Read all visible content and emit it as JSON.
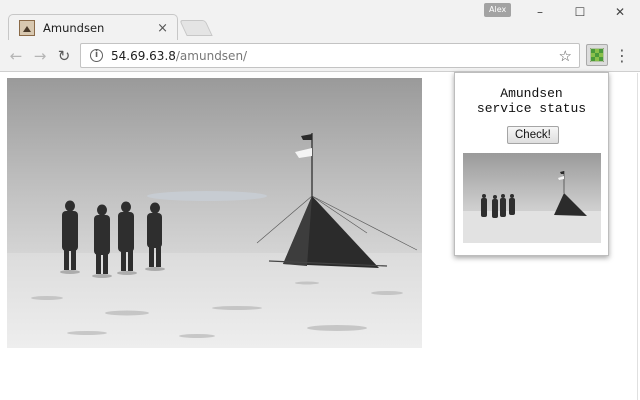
{
  "window": {
    "profile_name": "Alex",
    "minimize_icon": "minimize-icon",
    "maximize_icon": "maximize-icon",
    "close_icon": "close-icon"
  },
  "tab": {
    "title": "Amundsen",
    "favicon": "picture-favicon",
    "close_glyph": "×"
  },
  "toolbar": {
    "back_glyph": "←",
    "forward_glyph": "→",
    "reload_glyph": "↻",
    "url_host": "54.69.63.8",
    "url_path": "/amundsen/",
    "star_glyph": "☆",
    "menu_glyph": "⋮"
  },
  "extension_popup": {
    "title_line1": "Amundsen",
    "title_line2": "service status",
    "check_button_label": "Check!",
    "thumbnail_icon": "amundsen-photo-thumbnail"
  },
  "page": {
    "image_icon": "amundsen-south-pole-photo"
  },
  "colors": {
    "chrome_bg": "#f2f2f2",
    "profile_badge": "#a3a3a3",
    "url_path_gray": "#777777"
  }
}
